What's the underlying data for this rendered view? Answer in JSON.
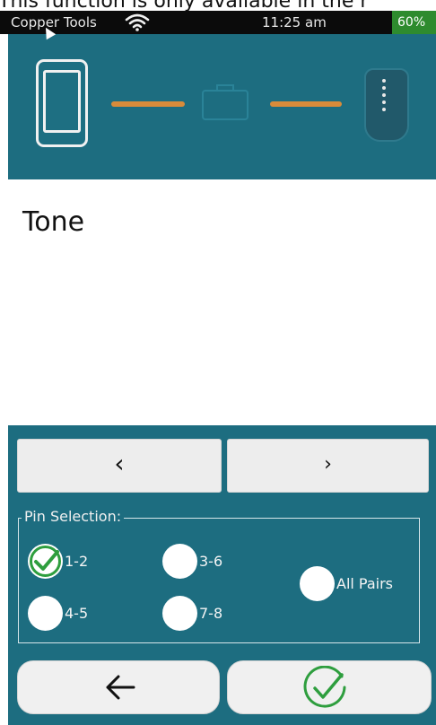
{
  "caption": "This function is only available in the r",
  "status_bar": {
    "app_name": "Copper Tools",
    "wifi_icon": "wifi-icon",
    "time": "11:25 am",
    "battery": "60%",
    "battery_color": "#2e8b2e"
  },
  "connection_diagram": {
    "device_icon": "tester-phone-icon",
    "link_color": "#d88b3a",
    "connector_icon": "rj45-connector-icon",
    "remote_icon": "remote-unit-icon"
  },
  "main": {
    "title": "Tone"
  },
  "navigation": {
    "prev_label": "‹",
    "next_label": "›"
  },
  "pin_selection": {
    "legend": "Pin Selection:",
    "options": [
      {
        "label": "1-2",
        "checked": true
      },
      {
        "label": "3-6",
        "checked": false
      },
      {
        "label": "4-5",
        "checked": false
      },
      {
        "label": "7-8",
        "checked": false
      },
      {
        "label": "All Pairs",
        "checked": false
      }
    ]
  },
  "footer": {
    "back_icon": "arrow-left-icon",
    "confirm_icon": "check-circle-icon",
    "accent_color": "#2e9e3e"
  },
  "colors": {
    "background": "#1d6d80",
    "panel": "#ffffff"
  }
}
